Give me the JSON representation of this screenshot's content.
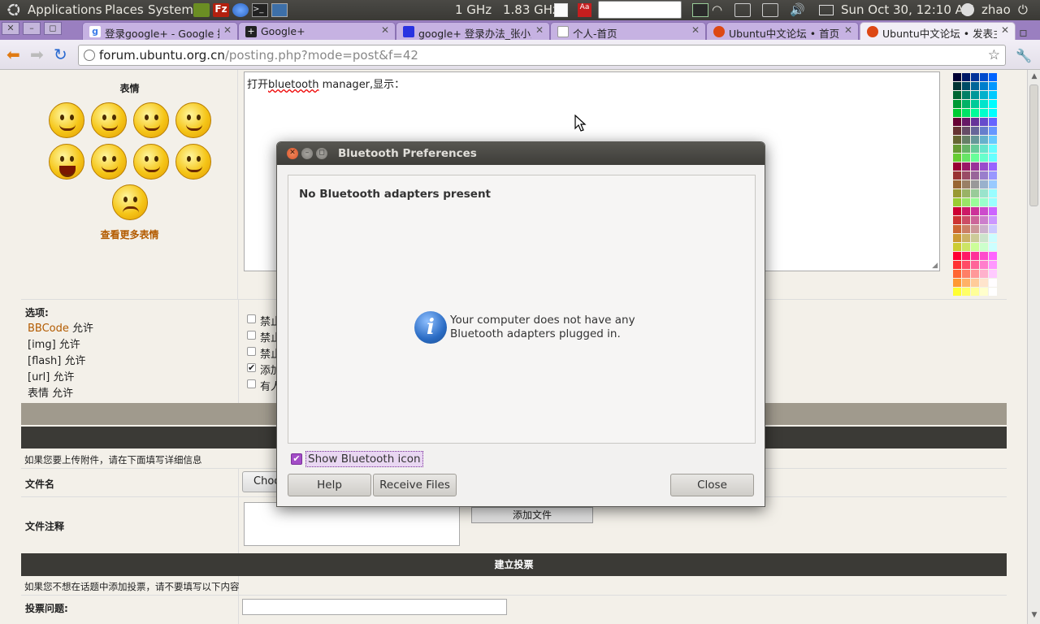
{
  "panel": {
    "menus": [
      "Applications",
      "Places",
      "System"
    ],
    "cpu1": "1 GHz",
    "cpu2": "1.83 GHz",
    "clock": "Sun Oct 30, 12:10 AM",
    "user": "zhao"
  },
  "tabs": [
    {
      "title": "登录google+ - Google 搜索",
      "favicon_color": "#3b7be8"
    },
    {
      "title": "Google+",
      "favicon_color": "#222222"
    },
    {
      "title": "google+ 登录办法_张小灵_",
      "favicon_color": "#2932e1"
    },
    {
      "title": "个人-首页",
      "favicon_color": "#ffffff"
    },
    {
      "title": "Ubuntu中文论坛 • 首页",
      "favicon_color": "#dd4814"
    },
    {
      "title": "Ubuntu中文论坛 • 发表主题",
      "favicon_color": "#dd4814"
    }
  ],
  "omnibox": {
    "host": "forum.ubuntu.org.cn",
    "path": "/posting.php?mode=post&f=42"
  },
  "editor": {
    "text_prefix": "打开",
    "text_misspelled": "bluetooth",
    "text_suffix": " manager,显示："
  },
  "smilies": {
    "title": "表情",
    "more_link": "查看更多表情"
  },
  "options": {
    "title": "选项:",
    "bbcode_link": "BBCode",
    "bbcode_suffix": " 允许",
    "img": "[img] 允许",
    "flash": "[flash] 允许",
    "url": "[url] 允许",
    "smilies": "表情 允许",
    "checkbox_labels": [
      "禁止",
      "禁止",
      "禁止",
      "添加",
      "有人"
    ]
  },
  "attach": {
    "hint": "如果您要上传附件，请在下面填写详细信息",
    "filename_label": "文件名",
    "choose_button": "Choo",
    "comment_label": "文件注释",
    "add_button": "添加文件"
  },
  "poll": {
    "header": "建立投票",
    "hint": "如果您不想在话题中添加投票，请不要填写以下内容",
    "question_label": "投票问题:"
  },
  "dialog": {
    "title": "Bluetooth Preferences",
    "header": "No Bluetooth adapters present",
    "info_line1": "Your computer does not have any",
    "info_line2": "Bluetooth adapters plugged in.",
    "info_icon": "i",
    "show_icon_label": "Show Bluetooth icon",
    "help_button": "Help",
    "receive_button": "Receive Files",
    "close_button": "Close"
  },
  "colors": {
    "panel_bg": "#3c3b37",
    "tabbar_bg": "#9a7fc0",
    "active_tab": "#f1eef6",
    "accent_check": "#a34dc7",
    "link_color": "#b35b00",
    "header_bar": "#3b3a36"
  }
}
